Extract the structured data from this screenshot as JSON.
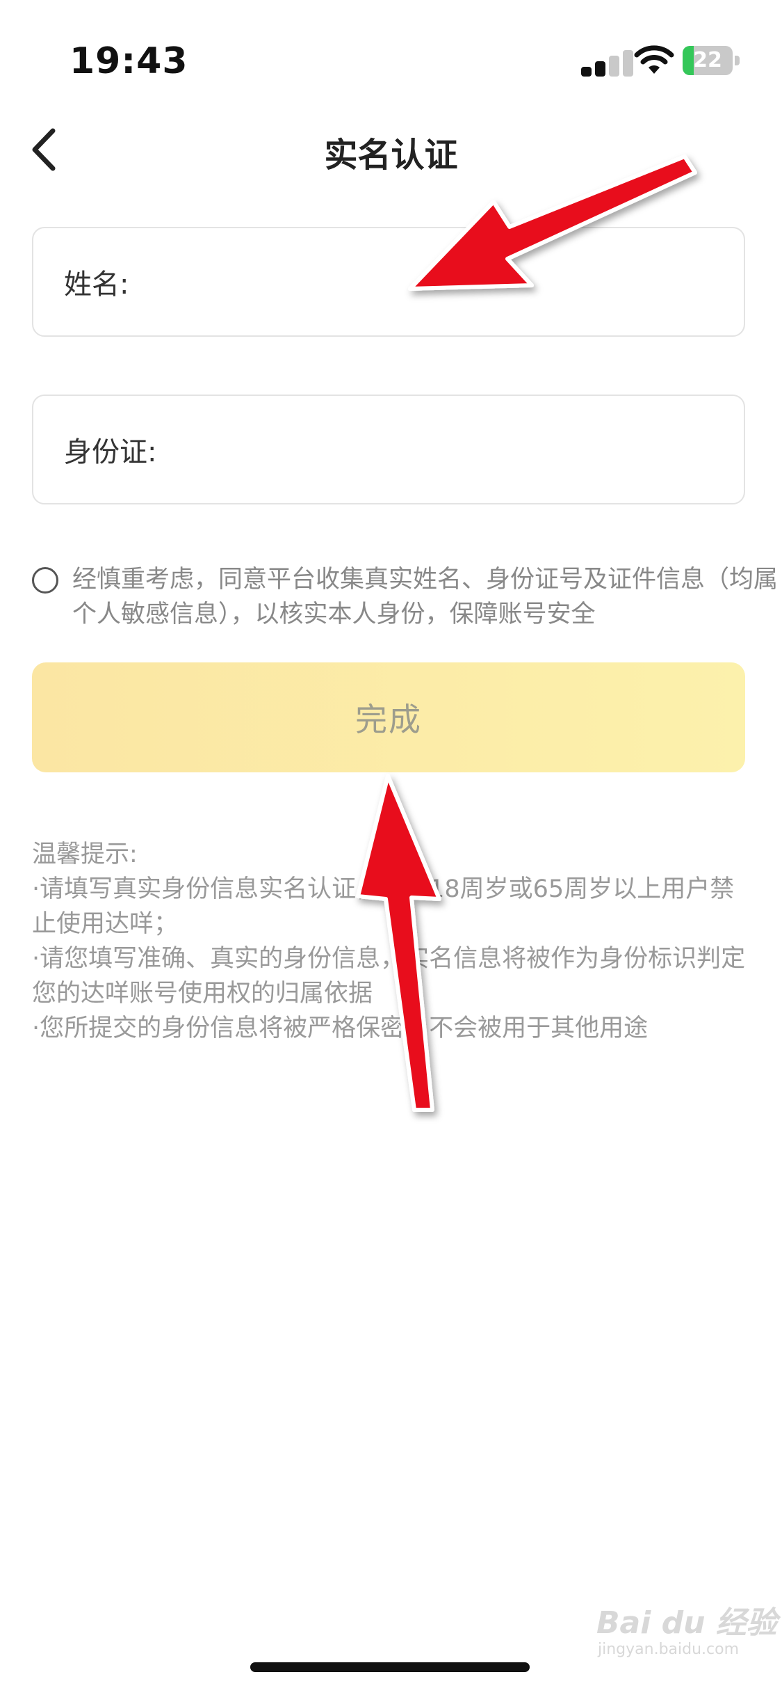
{
  "status_bar": {
    "time": "19:43",
    "battery_percent": "22",
    "colors": {
      "battery_fill": "#34c759"
    }
  },
  "nav": {
    "back_icon": "chevron-left-icon",
    "title": "实名认证"
  },
  "form": {
    "name_label": "姓名:",
    "name_value": "",
    "id_label": "身份证:",
    "id_value": ""
  },
  "consent": {
    "checked": false,
    "text": "经慎重考虑，同意平台收集真实姓名、身份证号及证件信息（均属个人敏感信息），以核实本人身份，保障账号安全"
  },
  "submit": {
    "label": "完成",
    "colors": {
      "gradient_start": "#fbe6a3",
      "gradient_end": "#fcf1ac",
      "text": "#9d9d8d"
    }
  },
  "tips": {
    "heading": "温馨提示:",
    "lines": [
      "·请填写真实身份信息实名认证，未满18周岁或65周岁以上用户禁止使用达咩；",
      "·请您填写准确、真实的身份信息，实名信息将被作为身份标识判定您的达咩账号使用权的归属依据",
      "·您所提交的身份信息将被严格保密，不会被用于其他用途"
    ]
  },
  "annotations": {
    "arrow_color": "#e8111c",
    "arrows": [
      "arrow-to-name-field",
      "arrow-to-submit-button"
    ]
  },
  "watermark": {
    "logo": "Bai du 经验",
    "url": "jingyan.baidu.com"
  }
}
